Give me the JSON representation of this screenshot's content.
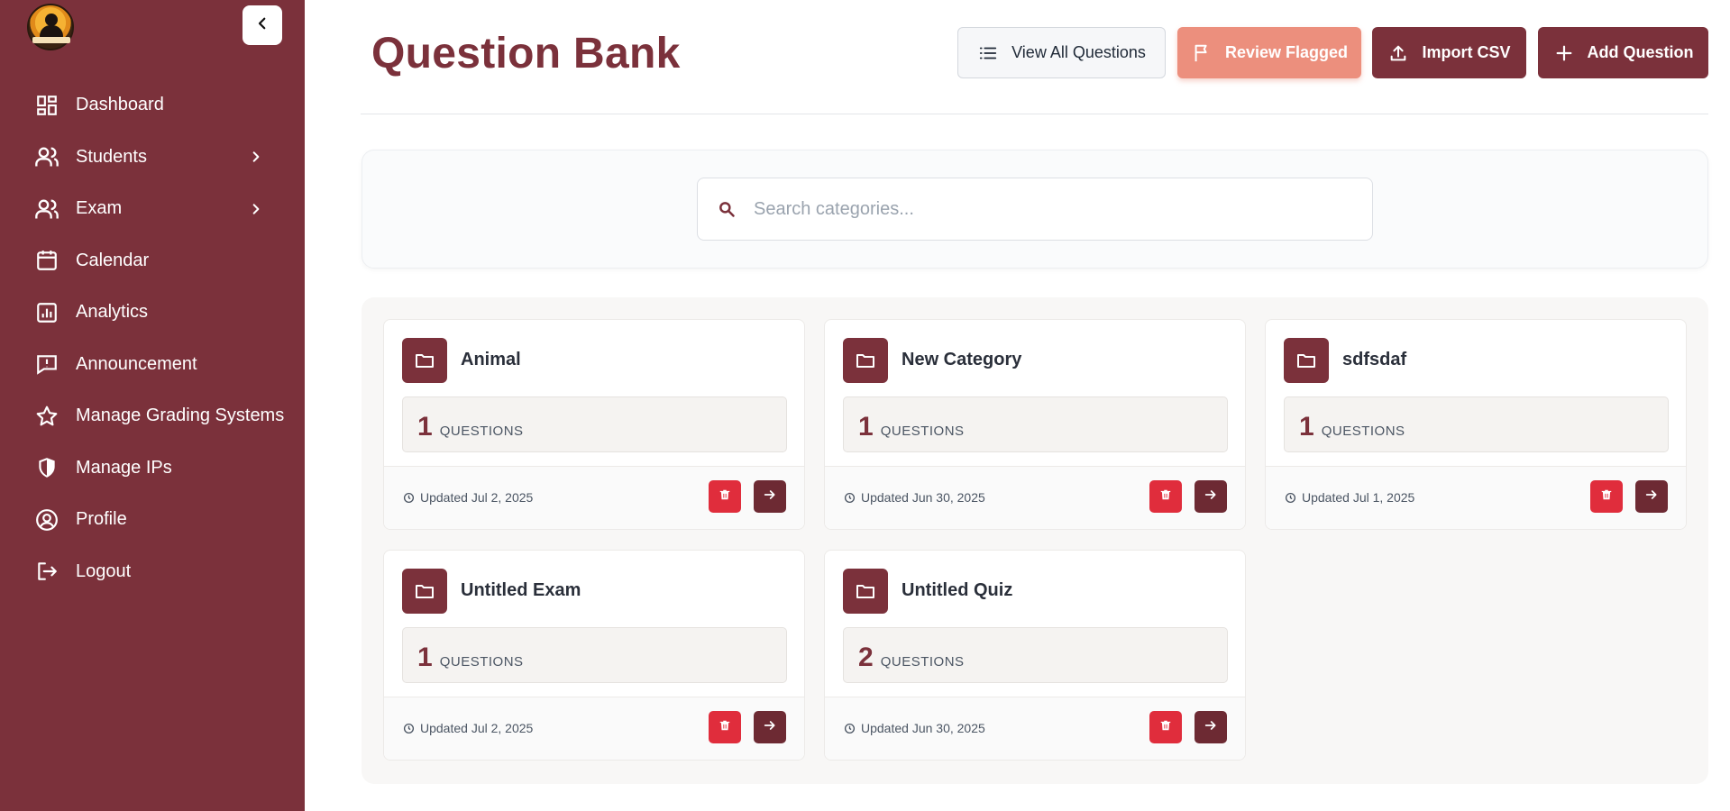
{
  "sidebar": {
    "logo_text": "STREAMS",
    "items": [
      {
        "label": "Dashboard",
        "icon": "dashboard-icon",
        "has_submenu": false
      },
      {
        "label": "Students",
        "icon": "users-icon",
        "has_submenu": true
      },
      {
        "label": "Exam",
        "icon": "users-icon",
        "has_submenu": true
      },
      {
        "label": "Calendar",
        "icon": "calendar-icon",
        "has_submenu": false
      },
      {
        "label": "Analytics",
        "icon": "analytics-icon",
        "has_submenu": false
      },
      {
        "label": "Announcement",
        "icon": "announcement-icon",
        "has_submenu": false
      },
      {
        "label": "Manage Grading Systems",
        "icon": "star-icon",
        "has_submenu": false
      },
      {
        "label": "Manage IPs",
        "icon": "shield-icon",
        "has_submenu": false
      },
      {
        "label": "Profile",
        "icon": "profile-icon",
        "has_submenu": false
      },
      {
        "label": "Logout",
        "icon": "logout-icon",
        "has_submenu": false
      }
    ]
  },
  "header": {
    "title": "Question Bank",
    "buttons": {
      "view_all": "View All Questions",
      "review_flagged": "Review Flagged",
      "import_csv": "Import CSV",
      "add_question": "Add Question"
    }
  },
  "search": {
    "placeholder": "Search categories...",
    "value": ""
  },
  "categories": [
    {
      "name": "Animal",
      "count": "1",
      "count_label": "QUESTIONS",
      "updated": "Updated Jul 2, 2025"
    },
    {
      "name": "New Category",
      "count": "1",
      "count_label": "QUESTIONS",
      "updated": "Updated Jun 30, 2025"
    },
    {
      "name": "sdfsdaf",
      "count": "1",
      "count_label": "QUESTIONS",
      "updated": "Updated Jul 1, 2025"
    },
    {
      "name": "Untitled Exam",
      "count": "1",
      "count_label": "QUESTIONS",
      "updated": "Updated Jul 2, 2025"
    },
    {
      "name": "Untitled Quiz",
      "count": "2",
      "count_label": "QUESTIONS",
      "updated": "Updated Jun 30, 2025"
    }
  ],
  "colors": {
    "brand": "#7b313b",
    "flagged": "#ec8f7d",
    "delete": "#e02d3c"
  }
}
